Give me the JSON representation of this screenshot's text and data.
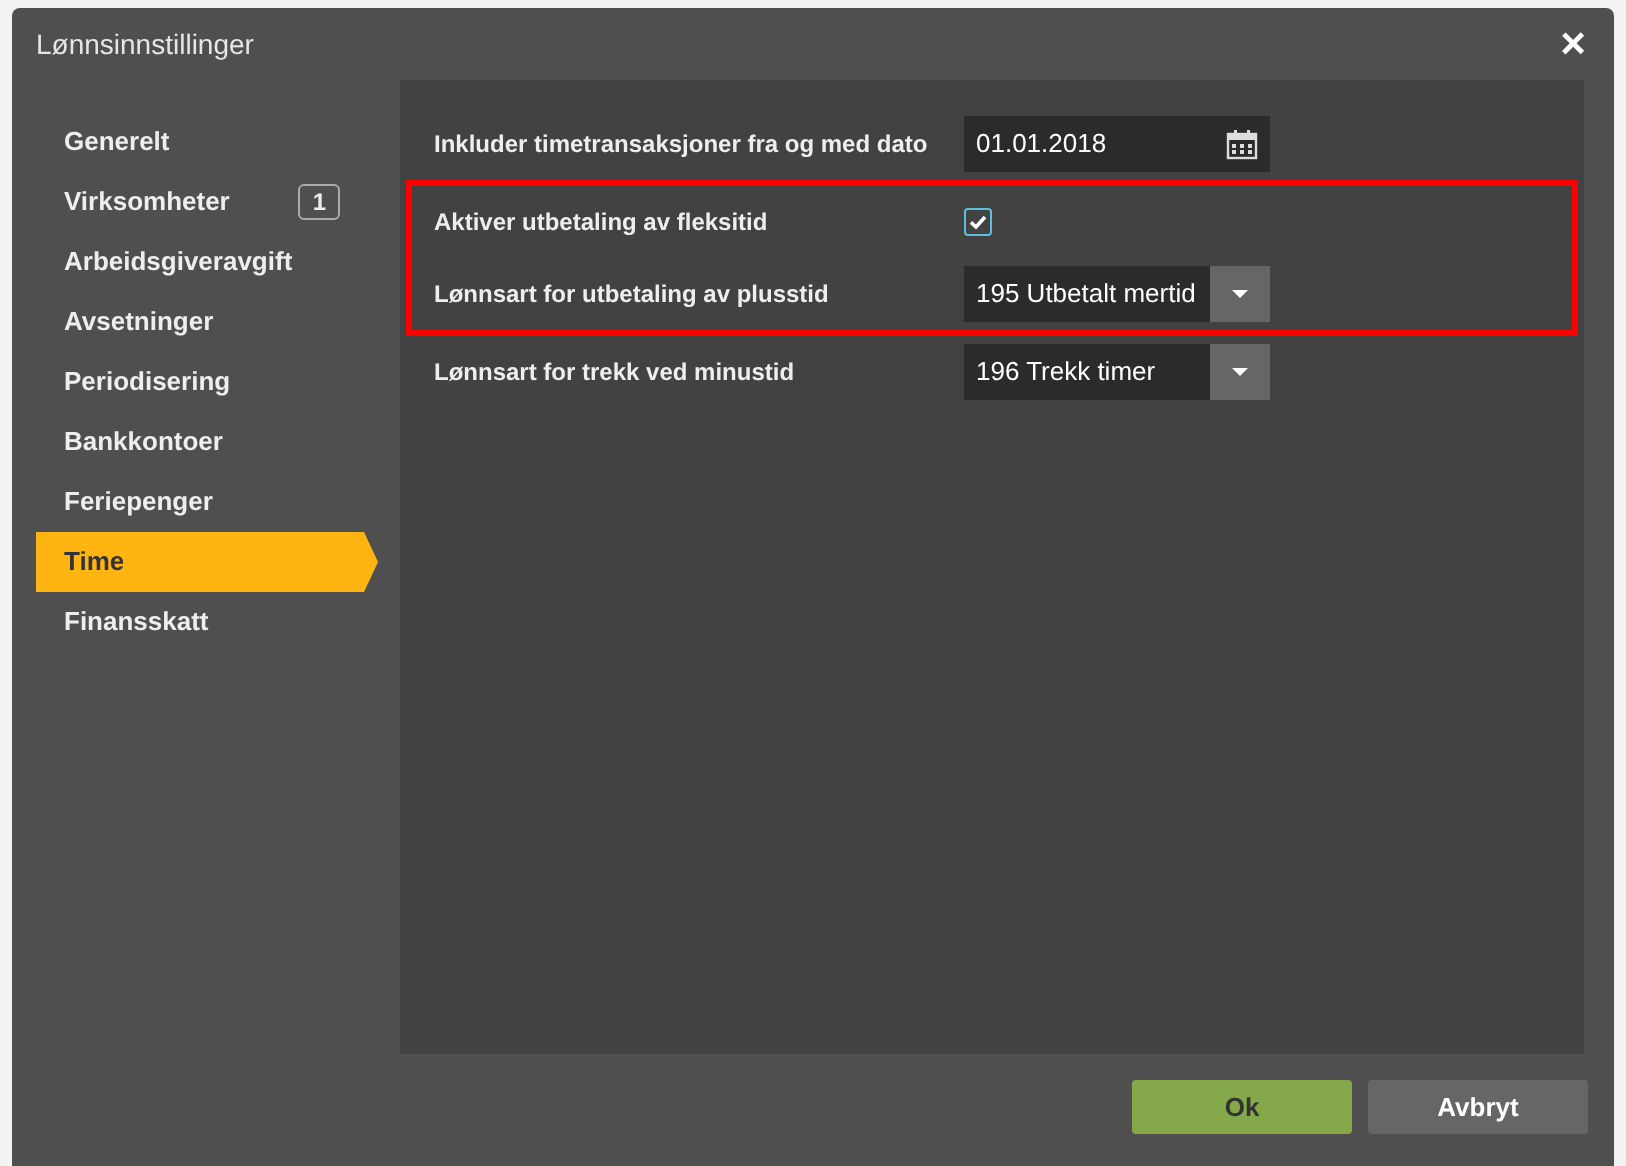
{
  "window": {
    "title": "Lønnsinnstillinger",
    "close": "×"
  },
  "sidebar": {
    "items": [
      {
        "label": "Generelt",
        "selected": false
      },
      {
        "label": "Virksomheter",
        "badge": "1",
        "selected": false
      },
      {
        "label": "Arbeidsgiveravgift",
        "selected": false
      },
      {
        "label": "Avsetninger",
        "selected": false
      },
      {
        "label": "Periodisering",
        "selected": false
      },
      {
        "label": "Bankkontoer",
        "selected": false
      },
      {
        "label": "Feriepenger",
        "selected": false
      },
      {
        "label": "Time",
        "selected": true
      },
      {
        "label": "Finansskatt",
        "selected": false
      }
    ]
  },
  "settings": [
    {
      "kind": "date",
      "label": "Inkluder timetransaksjoner fra og med dato",
      "value": "01.01.2018",
      "highlighted": false
    },
    {
      "kind": "checkbox",
      "label": "Aktiver utbetaling av fleksitid",
      "checked": true,
      "highlighted": true
    },
    {
      "kind": "select",
      "label": "Lønnsart for utbetaling av plusstid",
      "value": "195 Utbetalt mertid",
      "highlighted": true
    },
    {
      "kind": "select",
      "label": "Lønnsart for trekk ved minustid",
      "value": "196 Trekk timer",
      "highlighted": false
    }
  ],
  "buttons": [
    {
      "label": "Ok",
      "kind": "primary"
    },
    {
      "label": "Avbryt",
      "kind": "secondary"
    }
  ]
}
